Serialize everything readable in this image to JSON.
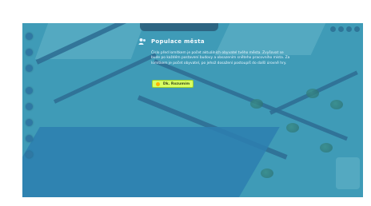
{
  "game": {
    "top_banner_text": "",
    "tooltip": {
      "title": "Populace města",
      "body": "Číslo před lomítkem je počet aktuálních obyvatel tvého města. Zvyšovat se bude po každém postavení budovy a obsazením sněteho pracovního místa. Za lomítkem je počet obyvatel, po jehož dosažení postoupíš do další úrovně hry.",
      "button_label": "Dk. Rozumím"
    }
  },
  "colors": {
    "overlay": "#3f9bb7",
    "road": "#2f6f95",
    "button": "#d8ff62"
  },
  "icons": {
    "tooltip_icon": "people-icon",
    "button_icon": "coin-icon"
  }
}
